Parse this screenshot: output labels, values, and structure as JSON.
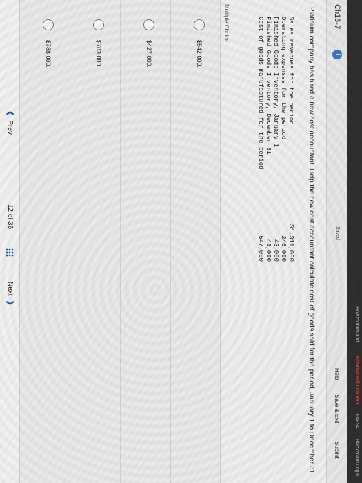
{
  "topbar": {
    "links": [
      "How to form and...",
      "McGraw-Hill Connect",
      "FAFSA",
      "Blackboard Login"
    ]
  },
  "header": {
    "question_label": "Ch13-7",
    "info_icon": "i",
    "saved": "Saved",
    "help": "Help",
    "save_exit": "Save & Exit",
    "submit": "Submit"
  },
  "question": {
    "prompt": "Platinum company has hired a new cost accountant. Help the new cost accountant calculate cost of goods sold for the period, January 1 to December 31."
  },
  "data_table": {
    "rows": [
      {
        "label": "Sales revenues for the period",
        "value": "$1,311,000"
      },
      {
        "label": "Operating expenses for the period",
        "value": "246,000"
      },
      {
        "label": "Finished Goods Inventory, January 1",
        "value": "43,000"
      },
      {
        "label": "Finished Goods Inventory, December 31",
        "value": "48,000"
      },
      {
        "label": "Cost of goods manufactured for the period",
        "value": "547,000"
      }
    ]
  },
  "multiple_choice": {
    "label": "Multiple Choice",
    "options": [
      "$542,000.",
      "$427,000.",
      "$783,000.",
      "$788,000."
    ]
  },
  "footer": {
    "prev": "Prev",
    "current": "12",
    "of": "of",
    "total": "36",
    "next": "Next"
  },
  "colors": {
    "accent_blue": "#1f5fa9",
    "info_blue": "#3b78c4"
  }
}
